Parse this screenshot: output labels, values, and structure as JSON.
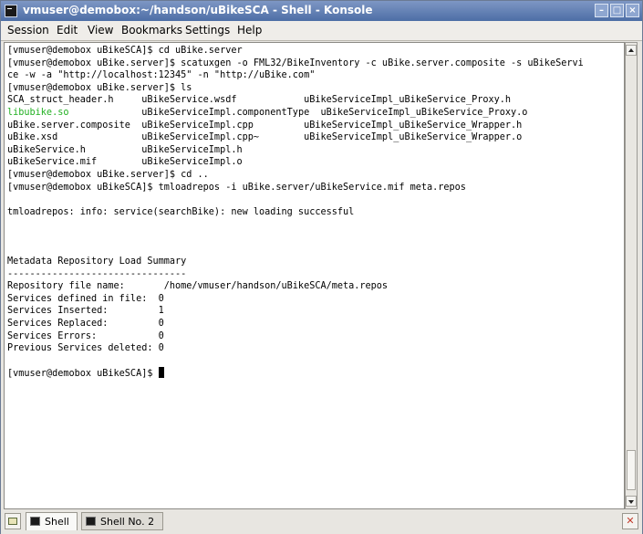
{
  "window": {
    "title": "vmuser@demobox:~/handson/uBikeSCA - Shell - Konsole"
  },
  "menubar": {
    "items": [
      "Session",
      "Edit",
      "View",
      "Bookmarks",
      "Settings",
      "Help"
    ]
  },
  "terminal": {
    "lines": [
      "[vmuser@demobox uBikeSCA]$ cd uBike.server",
      "[vmuser@demobox uBike.server]$ scatuxgen -o FML32/BikeInventory -c uBike.server.composite -s uBikeServi",
      "ce -w -a \"http://localhost:12345\" -n \"http://uBike.com\"",
      "[vmuser@demobox uBike.server]$ ls",
      "SCA_struct_header.h     uBikeService.wsdf            uBikeServiceImpl_uBikeService_Proxy.h",
      "libubike.so             uBikeServiceImpl.componentType  uBikeServiceImpl_uBikeService_Proxy.o",
      "uBike.server.composite  uBikeServiceImpl.cpp         uBikeServiceImpl_uBikeService_Wrapper.h",
      "uBike.xsd               uBikeServiceImpl.cpp~        uBikeServiceImpl_uBikeService_Wrapper.o",
      "uBikeService.h          uBikeServiceImpl.h",
      "uBikeService.mif        uBikeServiceImpl.o",
      "[vmuser@demobox uBike.server]$ cd ..",
      "[vmuser@demobox uBikeSCA]$ tmloadrepos -i uBike.server/uBikeService.mif meta.repos",
      "",
      "tmloadrepos: info: service(searchBike): new loading successful",
      "",
      "",
      "",
      "Metadata Repository Load Summary",
      "--------------------------------",
      "Repository file name:       /home/vmuser/handson/uBikeSCA/meta.repos",
      "Services defined in file:  0",
      "Services Inserted:         1",
      "Services Replaced:         0",
      "Services Errors:           0",
      "Previous Services deleted: 0",
      "",
      "[vmuser@demobox uBikeSCA]$ "
    ],
    "highlighted_file": "libubike.so",
    "highlight_color": "#22b022"
  },
  "tabs": [
    {
      "label": "Shell",
      "active": true
    },
    {
      "label": "Shell No. 2",
      "active": false
    }
  ],
  "icons": {
    "window": "konsole-terminal-icon",
    "new_tab": "new-session-icon",
    "close_tab": "close-session-icon"
  }
}
